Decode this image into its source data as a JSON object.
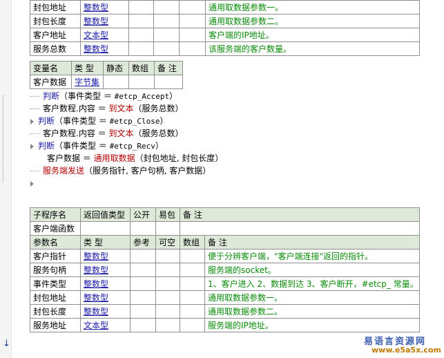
{
  "top_params": {
    "rows": [
      {
        "name": "封包地址",
        "type": "整数型",
        "remark": "通用取数据参数一。"
      },
      {
        "name": "封包长度",
        "type": "整数型",
        "remark": "通用取数据参数二。"
      },
      {
        "name": "客户地址",
        "type": "文本型",
        "remark": "客户端的IP地址。"
      },
      {
        "name": "服务总数",
        "type": "整数型",
        "remark": "该服务端的客户数量。"
      }
    ]
  },
  "var_table": {
    "headers": [
      "变量名",
      "类 型",
      "静态",
      "数组",
      "备 注"
    ],
    "rows": [
      {
        "name": "客户数据",
        "type": "字节集"
      }
    ]
  },
  "code": {
    "l1_kw": "判断",
    "l1_rest": "（事件类型 ＝ ",
    "l1_const": "#etcp_Accept",
    "l1_end": "）",
    "l2_a": "客户数程.内容 ＝ ",
    "l2_fn": "到文本",
    "l2_b": "（服务总数）",
    "l3_kw": "判断",
    "l3_rest": "（事件类型 ＝ ",
    "l3_const": "#etcp_Close",
    "l3_end": "）",
    "l4_a": "客户数程.内容 ＝ ",
    "l4_fn": "到文本",
    "l4_b": "（服务总数）",
    "l5_kw": "判断",
    "l5_rest": "（事件类型 ＝ ",
    "l5_const": "#etcp_Recv",
    "l5_end": "）",
    "l6_a": "客户数据 ＝ ",
    "l6_fn": "通用取数据",
    "l6_b": "（封包地址, 封包长度）",
    "l7_fn": "服务端发送",
    "l7_b": "（服务指针, 客户句柄, 客户数据）"
  },
  "sub": {
    "headers": [
      "子程序名",
      "返回值类型",
      "公开",
      "易包",
      "备 注"
    ],
    "name": "客户端函数",
    "param_headers": [
      "参数名",
      "类 型",
      "参考",
      "可空",
      "数组",
      "备 注"
    ],
    "params": [
      {
        "name": "客户指针",
        "type": "整数型",
        "remark": "便于分辨客户端，\"客户端连接\"返回的指针。"
      },
      {
        "name": "服务句柄",
        "type": "整数型",
        "remark": "服务端的socket。"
      },
      {
        "name": "事件类型",
        "type": "整数型",
        "remark": "1、客户进入 2、数据到达 3、客户断开，#etcp_ 常量。"
      },
      {
        "name": "封包地址",
        "type": "整数型",
        "remark": "通用取数据参数一。"
      },
      {
        "name": "封包长度",
        "type": "整数型",
        "remark": "通用取数据参数二。"
      },
      {
        "name": "服务地址",
        "type": "文本型",
        "remark": "服务端的IP地址。"
      }
    ]
  },
  "watermark": {
    "top": "易语言资源网",
    "bottom": "www.e5a5x.com"
  },
  "colors": {
    "header_bg": "#dfe9da",
    "type_blue": "#1a1aa6",
    "remark_green": "#0a8a0a",
    "func_red": "#b00000"
  }
}
